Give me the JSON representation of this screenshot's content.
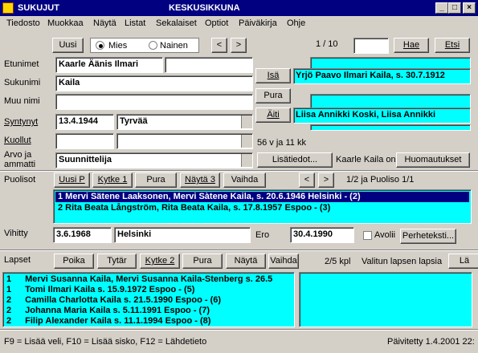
{
  "window": {
    "title": "SUKUJUT",
    "subtitle": "KESKUSIKKUNA"
  },
  "menu": [
    "Tiedosto",
    "Muokkaa",
    "Näytä",
    "Listat",
    "Sekalaiset",
    "Optiot",
    "Päiväkirja",
    "Ohje"
  ],
  "toolbar": {
    "new_label": "Uusi",
    "gender_male": "Mies",
    "gender_female": "Nainen",
    "prev_label": "<",
    "next_label": ">",
    "record_counter": "1 / 10",
    "search_value": "",
    "search_label": "Hae",
    "find_label": "Etsi"
  },
  "person": {
    "firstnames_label": "Etunimet",
    "firstnames": "Kaarle Äänis Ilmari",
    "surname_label": "Sukunimi",
    "surname": "Kaila",
    "othername_label": "Muu nimi",
    "othername": "",
    "born_label": "Syntynyt",
    "born_date": "13.4.1944",
    "born_place": "Tyrvää",
    "died_label": "Kuollut",
    "died_date": "",
    "died_place": "",
    "age": "56 v ja 11 kk",
    "title_label_1": "Arvo ja",
    "title_label_2": "ammatti",
    "title_value": "Suunnittelija",
    "extra_info_label": "Lisätiedot...",
    "notes_of": "Kaarle Kaila on",
    "remarks_label": "Huomautukset"
  },
  "parents": {
    "father_label": "Isä",
    "father_value": "Yrjö Paavo Ilmari Kaila,  s. 30.7.1912",
    "pura_label": "Pura",
    "mother_label": "Äiti",
    "mother_value": "Liisa Annikki Koski, Liisa Annikki"
  },
  "spouses": {
    "label": "Puolisot",
    "buttons": [
      "Uusi P",
      "Kytke 1",
      "Pura",
      "Näytä 3",
      "Vaihda"
    ],
    "prev": "<",
    "next": ">",
    "counter": "1/2 ja Puoliso 1/1",
    "rows": [
      "1  Mervi Sätene Laaksonen, Mervi Sàtene Kaila,  s. 20.6.1946 Helsinki - (2)",
      "2  Rita Beata Långström, Rita Beata Kaila,  s. 17.8.1957 Espoo - (3)"
    ],
    "married_label": "Vihitty",
    "married_date": "3.6.1968",
    "married_place": "Helsinki",
    "divorced_label": "Ero",
    "divorced_date": "30.4.1990",
    "avolii_label": "Avolii",
    "family_text_label": "Perheteksti..."
  },
  "children": {
    "label": "Lapset",
    "buttons": [
      "Poika",
      "Tytär",
      "Kytke 2",
      "Pura",
      "Näytä",
      "Vaihda"
    ],
    "count": "2/5 kpl",
    "children_of_label": "Valitun lapsen lapsia",
    "partial_button": "Lä",
    "rows": [
      {
        "num": "1",
        "text": "Mervi Susanna Kaila, Mervi Susanna Kaila-Stenberg s. 26.5"
      },
      {
        "num": "1",
        "text": "Tomi Ilmari Kaila s. 15.9.1972 Espoo - (5)"
      },
      {
        "num": "2",
        "text": "Camilla Charlotta Kaila s. 21.5.1990 Espoo - (6)"
      },
      {
        "num": "2",
        "text": "Johanna Maria Kaila s. 5.11.1991 Espoo - (7)"
      },
      {
        "num": "2",
        "text": "Filip Alexander Kaila s. 11.1.1994 Espoo - (8)"
      }
    ]
  },
  "status": {
    "hint": "F9 = Lisää veli, F10 = Lisää sisko, F12 = Lähdetieto",
    "updated": "Päivitetty 1.4.2001 22:"
  },
  "colors": {
    "titlebar": "#000080",
    "list_bg": "#00ffff",
    "face": "#d4d0c8"
  }
}
